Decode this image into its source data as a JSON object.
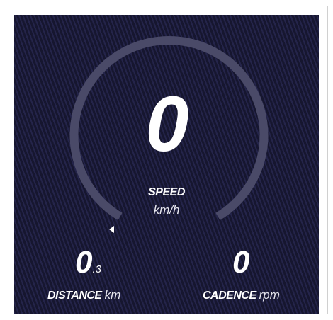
{
  "speed": {
    "value": "0",
    "label": "SPEED",
    "unit": "km/h"
  },
  "distance": {
    "value_main": "0",
    "value_decimal": ".3",
    "label": "DISTANCE",
    "unit": "km"
  },
  "cadence": {
    "value": "0",
    "label": "CADENCE",
    "unit": "rpm"
  },
  "icons": {
    "pointer": "triangle-left-icon"
  },
  "colors": {
    "background": "#1c1c3c",
    "gauge_arc": "#4a4a68",
    "text": "#ffffff"
  }
}
